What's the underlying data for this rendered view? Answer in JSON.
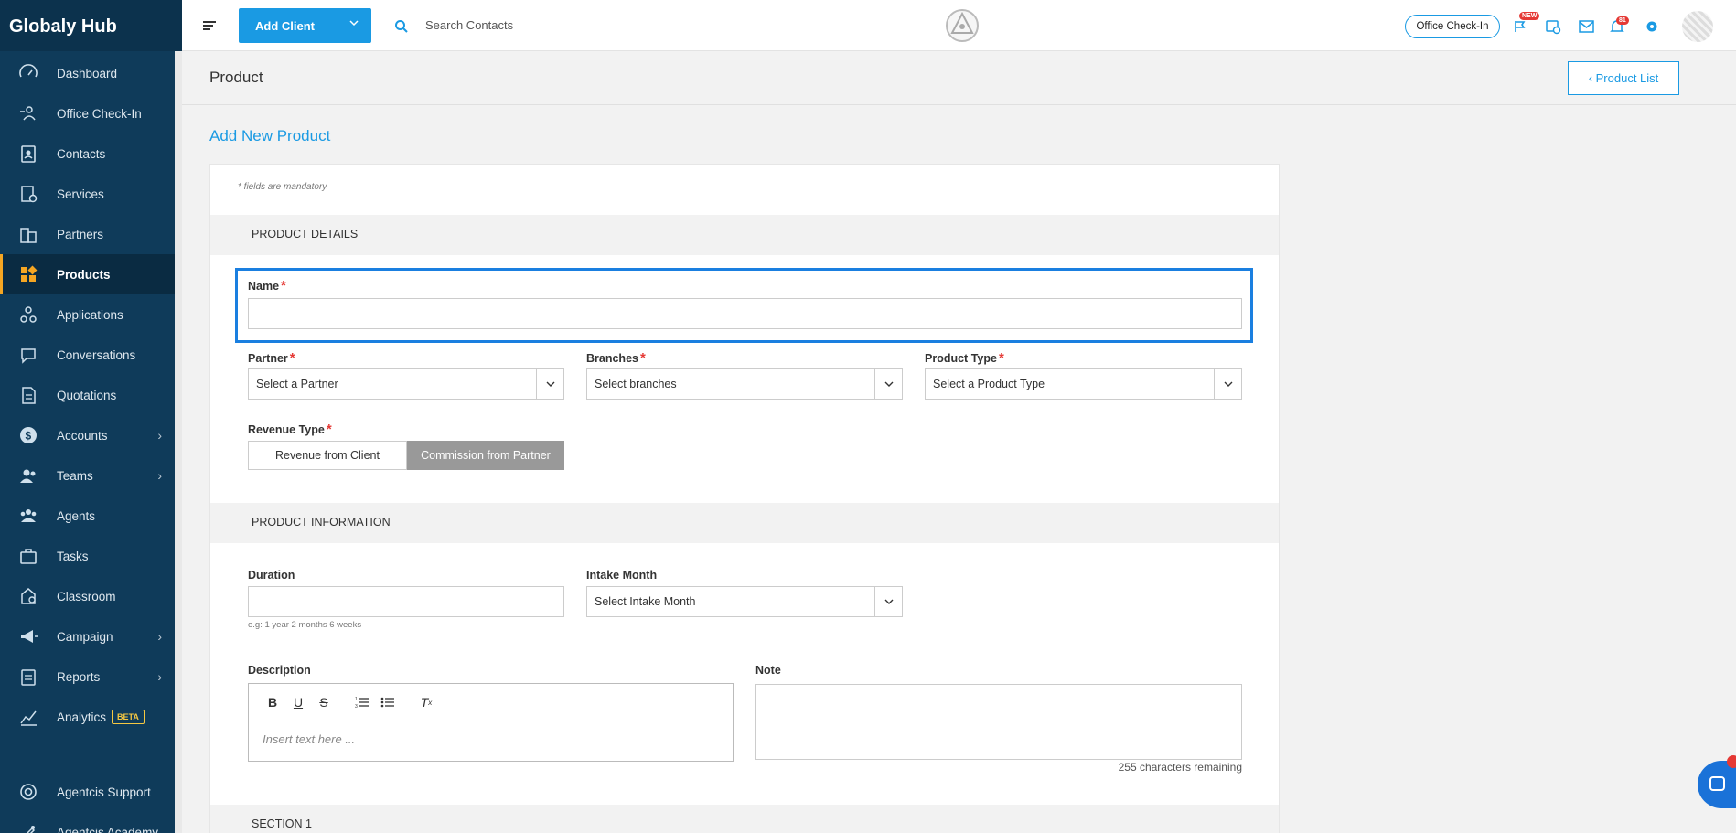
{
  "brand": "Globaly Hub",
  "nav": [
    {
      "label": "Dashboard",
      "icon": "dashboard-icon"
    },
    {
      "label": "Office Check-In",
      "icon": "checkin-icon"
    },
    {
      "label": "Contacts",
      "icon": "contacts-icon"
    },
    {
      "label": "Services",
      "icon": "services-icon"
    },
    {
      "label": "Partners",
      "icon": "partners-icon"
    },
    {
      "label": "Products",
      "icon": "products-icon",
      "active": true
    },
    {
      "label": "Applications",
      "icon": "applications-icon"
    },
    {
      "label": "Conversations",
      "icon": "conversations-icon"
    },
    {
      "label": "Quotations",
      "icon": "quotations-icon"
    },
    {
      "label": "Accounts",
      "icon": "accounts-icon",
      "expandable": true
    },
    {
      "label": "Teams",
      "icon": "teams-icon",
      "expandable": true
    },
    {
      "label": "Agents",
      "icon": "agents-icon"
    },
    {
      "label": "Tasks",
      "icon": "tasks-icon"
    },
    {
      "label": "Classroom",
      "icon": "classroom-icon"
    },
    {
      "label": "Campaign",
      "icon": "campaign-icon",
      "expandable": true
    },
    {
      "label": "Reports",
      "icon": "reports-icon",
      "expandable": true
    },
    {
      "label": "Analytics",
      "icon": "analytics-icon",
      "badge": "BETA"
    }
  ],
  "nav_bottom": [
    {
      "label": "Agentcis Support",
      "icon": "support-icon"
    },
    {
      "label": "Agentcis Academy",
      "icon": "academy-icon"
    }
  ],
  "topbar": {
    "add_client": "Add Client",
    "search_placeholder": "Search Contacts",
    "office_checkin": "Office Check-In",
    "new_badge": "NEW",
    "notif_badge": "81"
  },
  "page": {
    "title": "Product",
    "product_list": "Product List",
    "heading": "Add New Product"
  },
  "form": {
    "mandatory_note": "* fields are mandatory.",
    "product_details": "PRODUCT DETAILS",
    "name_label": "Name",
    "partner_label": "Partner",
    "partner_placeholder": "Select a Partner",
    "branches_label": "Branches",
    "branches_placeholder": "Select branches",
    "product_type_label": "Product Type",
    "product_type_placeholder": "Select a Product Type",
    "revenue_type_label": "Revenue Type",
    "revenue_from_client": "Revenue from Client",
    "commission_from_partner": "Commission from Partner",
    "product_information": "PRODUCT INFORMATION",
    "duration_label": "Duration",
    "duration_hint": "e.g: 1 year 2 months 6 weeks",
    "intake_label": "Intake Month",
    "intake_placeholder": "Select Intake Month",
    "description_label": "Description",
    "description_placeholder": "Insert text here ...",
    "note_label": "Note",
    "chars_remaining": "255 characters remaining",
    "section1": "SECTION 1",
    "required_mark": "*"
  },
  "colors": {
    "accent": "#1a9ae3",
    "sidebar": "#0f3b5a",
    "active_marker": "#f5a623"
  }
}
